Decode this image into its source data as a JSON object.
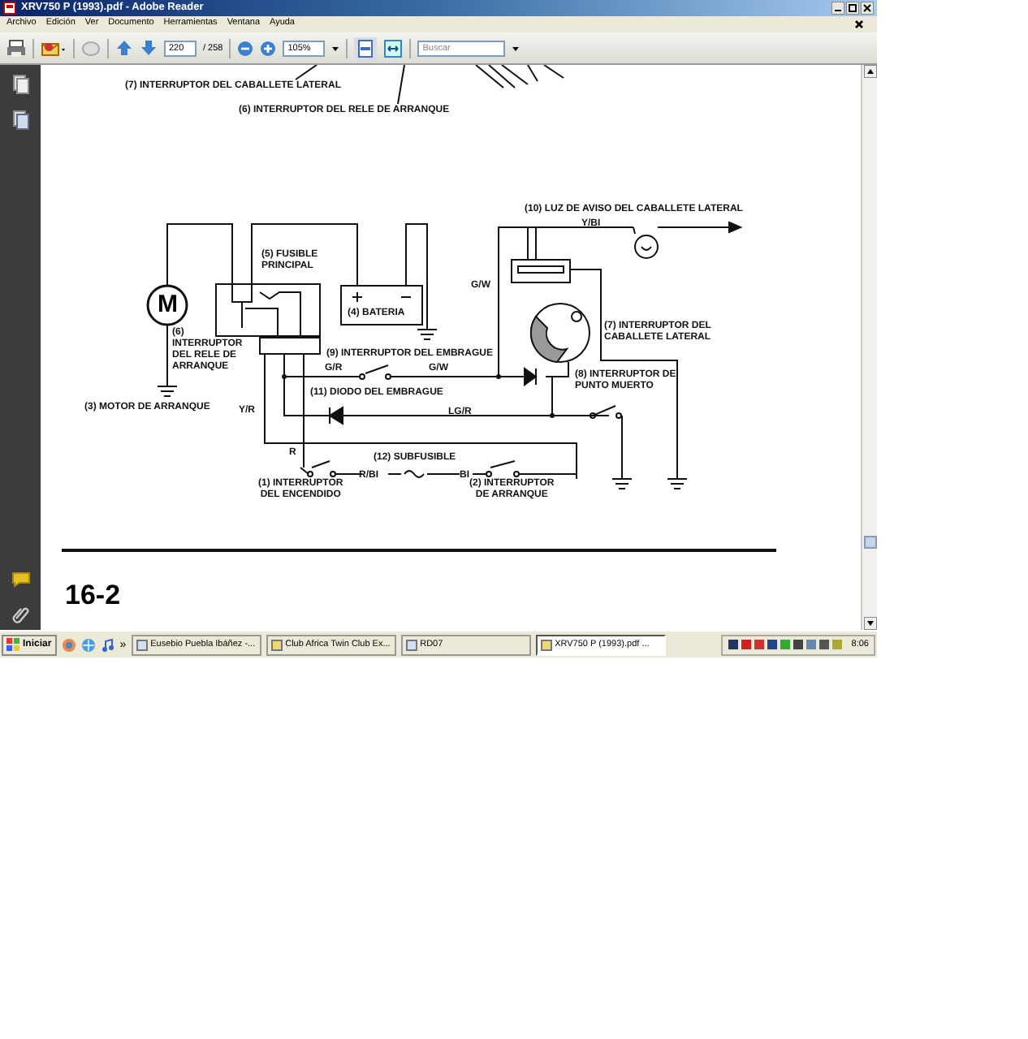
{
  "window": {
    "title": "XRV750 P (1993).pdf - Adobe Reader"
  },
  "menu": [
    "Archivo",
    "Edición",
    "Ver",
    "Documento",
    "Herramientas",
    "Ventana",
    "Ayuda"
  ],
  "toolbar": {
    "page_field": {
      "value": "220"
    },
    "page_count": "/ 258",
    "zoom_field": {
      "value": "105%"
    },
    "search_field": {
      "placeholder": "Buscar"
    }
  },
  "document": {
    "motor_letter": "M",
    "labels": [
      "(7) INTERRUPTOR DEL CABALLETE LATERAL",
      "(6) INTERRUPTOR DEL RELE DE ARRANQUE",
      "(10) LUZ DE AVISO DEL CABALLETE LATERAL",
      "Y/BI",
      "(5) FUSIBLE\nPRINCIPAL",
      "G/W",
      "(6)\nINTERRUPTOR\nDEL RELE DE\nARRANQUE",
      "(4) BATERIA",
      "(7) INTERRUPTOR DEL\nCABALLETE LATERAL",
      "(9) INTERRUPTOR DEL EMBRAGUE",
      "G/R",
      "G/W",
      "(8) INTERRUPTOR DE\nPUNTO MUERTO",
      "(11) DIODO DEL EMBRAGUE",
      "(3) MOTOR DE ARRANQUE",
      "Y/R",
      "LG/R",
      "R",
      "(12) SUBFUSIBLE",
      "R/BI",
      "BI",
      "(1) INTERRUPTOR\nDEL ENCENDIDO",
      "(2) INTERRUPTOR\nDE ARRANQUE"
    ],
    "page_number": "16-2"
  },
  "taskbar": {
    "start": "Iniciar",
    "more": "»",
    "tasks": [
      {
        "label": "Eusebio Puebla Ibáñez -...",
        "selected": false
      },
      {
        "label": "Club Africa Twin Club Ex...",
        "selected": false
      },
      {
        "label": "RD07",
        "selected": false
      },
      {
        "label": "XRV750 P (1993).pdf ...",
        "selected": true
      }
    ],
    "clock": "8:06"
  }
}
